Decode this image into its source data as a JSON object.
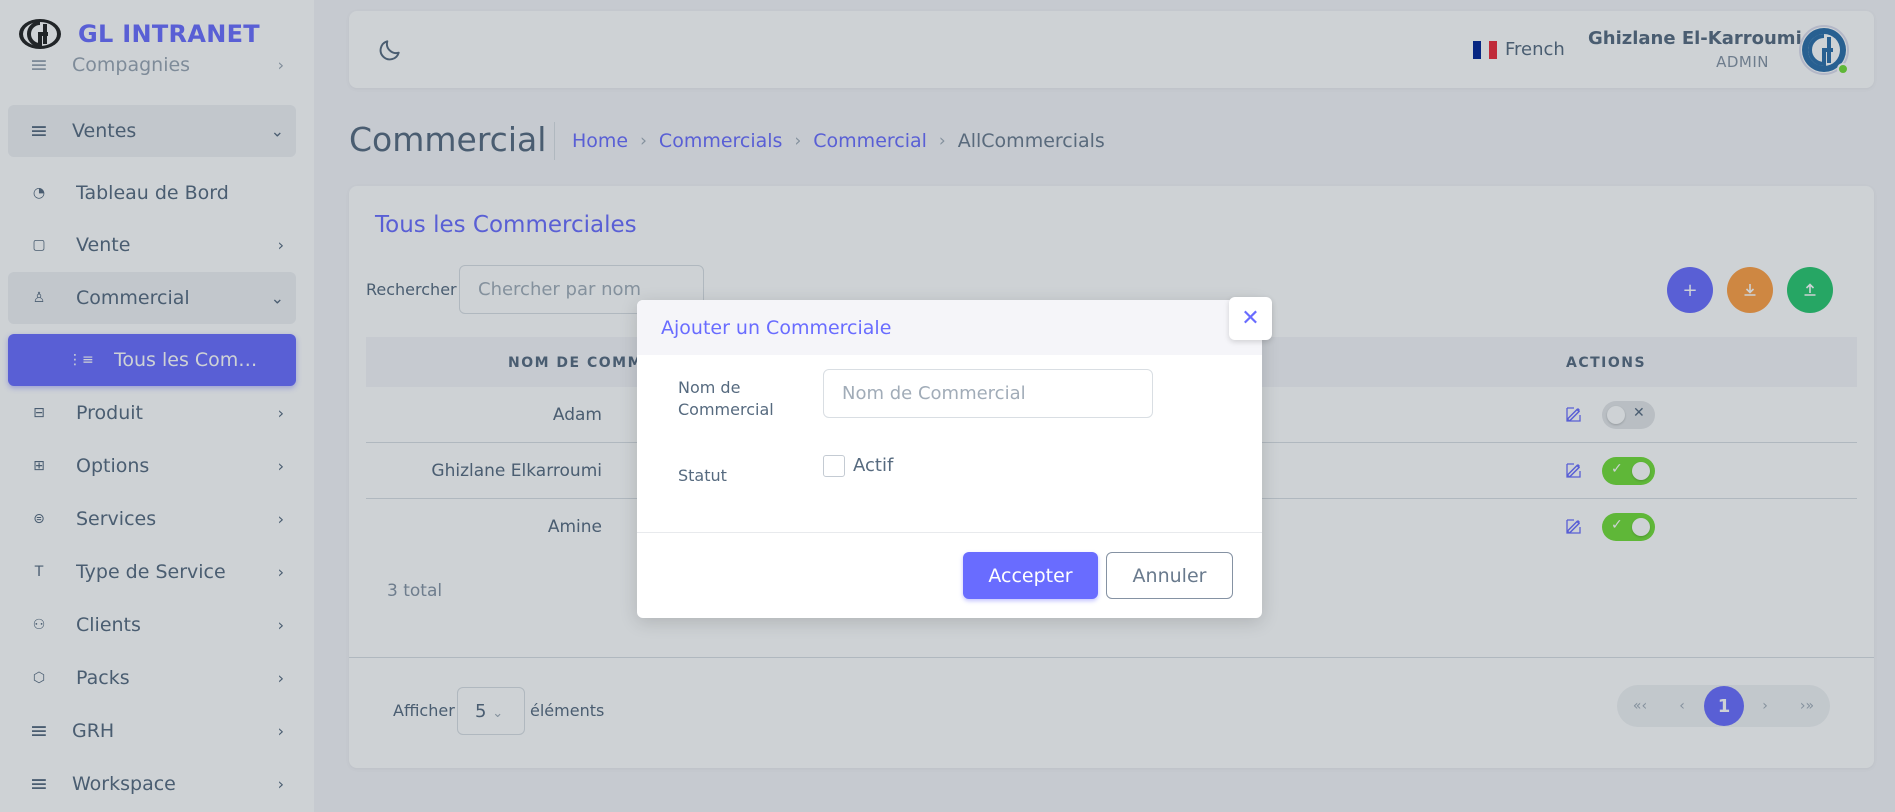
{
  "brand": {
    "name": "GL INTRANET"
  },
  "sidebar": {
    "items": [
      {
        "label": "Compagnies",
        "icon": "menu-icon"
      },
      {
        "label": "Ventes",
        "icon": "menu-icon"
      },
      {
        "label": "Tableau de Bord",
        "icon": "pie-chart-icon"
      },
      {
        "label": "Vente",
        "icon": "shopping-bag-icon"
      },
      {
        "label": "Commercial",
        "icon": "user-icon"
      },
      {
        "label": "Tous les Commerciales",
        "icon": "list-icon"
      },
      {
        "label": "Produit",
        "icon": "box-icon"
      },
      {
        "label": "Options",
        "icon": "grid-icon"
      },
      {
        "label": "Services",
        "icon": "server-icon"
      },
      {
        "label": "Type de Service",
        "icon": "text-icon"
      },
      {
        "label": "Clients",
        "icon": "users-icon"
      },
      {
        "label": "Packs",
        "icon": "package-icon"
      },
      {
        "label": "GRH",
        "icon": "menu-icon"
      },
      {
        "label": "Workspace",
        "icon": "menu-icon"
      }
    ]
  },
  "navbar": {
    "language": "French",
    "user_name": "Ghizlane El-Karroumi",
    "user_role": "ADMIN"
  },
  "page": {
    "title": "Commercial",
    "breadcrumb": [
      "Home",
      "Commercials",
      "Commercial",
      "AllCommercials"
    ]
  },
  "card": {
    "title": "Tous les Commerciales",
    "search_label": "Rechercher",
    "search_placeholder": "Chercher par nom",
    "columns": [
      "NOM DE COMMERCIAL",
      "ACTIONS"
    ],
    "rows": [
      {
        "name": "Adam",
        "active": false
      },
      {
        "name": "Ghizlane Elkarroumi",
        "active": true
      },
      {
        "name": "Amine",
        "active": true
      }
    ],
    "total": "3 total",
    "show_label": "Afficher",
    "page_size": "5",
    "elements_label": "éléments",
    "pager": {
      "first": "«‹",
      "prev": "‹",
      "current": "1",
      "next": "›",
      "last": "›»"
    }
  },
  "modal": {
    "title": "Ajouter un Commerciale",
    "name_label": "Nom de Commercial",
    "name_placeholder": "Nom de Commercial",
    "status_label": "Statut",
    "checkbox_label": "Actif",
    "accept_label": "Accepter",
    "cancel_label": "Annuler"
  },
  "colors": {
    "primary": "#696cff",
    "warning": "#ff9f43",
    "success": "#28c76f",
    "toggle_on": "#71dd37"
  }
}
